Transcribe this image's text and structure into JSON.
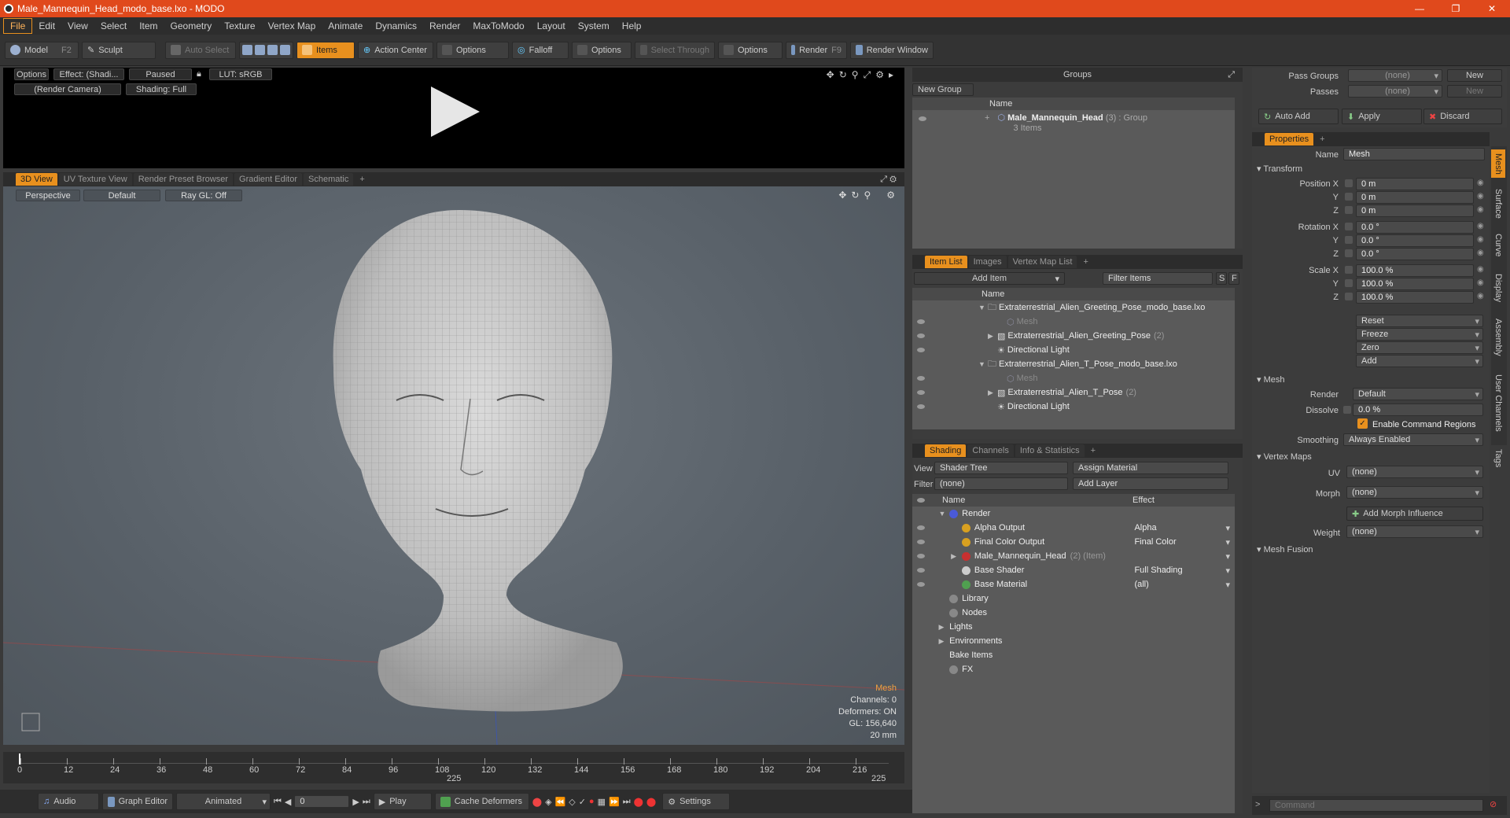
{
  "window": {
    "title": "Male_Mannequin_Head_modo_base.lxo - MODO",
    "min": "—",
    "max": "❐",
    "close": "✕"
  },
  "menu": [
    "File",
    "Edit",
    "View",
    "Select",
    "Item",
    "Geometry",
    "Texture",
    "Vertex Map",
    "Animate",
    "Dynamics",
    "Render",
    "MaxToModo",
    "Layout",
    "System",
    "Help"
  ],
  "toolbar": {
    "model": "Model",
    "model_key": "F2",
    "sculpt": "Sculpt",
    "auto_select": "Auto Select",
    "items": "Items",
    "action_center": "Action Center",
    "options1": "Options",
    "falloff": "Falloff",
    "options2": "Options",
    "select_through": "Select Through",
    "options3": "Options",
    "render": "Render",
    "render_key": "F9",
    "render_window": "Render Window"
  },
  "preview": {
    "options": "Options",
    "effect": "Effect: (Shadi...",
    "paused": "Paused",
    "lut": "LUT: sRGB",
    "camera": "(Render Camera)",
    "shading": "Shading: Full"
  },
  "viewport_tabs": [
    "3D View",
    "UV Texture View",
    "Render Preset Browser",
    "Gradient Editor",
    "Schematic",
    "+"
  ],
  "viewport": {
    "perspective": "Perspective",
    "default": "Default",
    "raygl": "Ray GL: Off",
    "info": {
      "mesh": "Mesh",
      "channels": "Channels: 0",
      "deformers": "Deformers: ON",
      "gl": "GL: 156,640",
      "scale": "20 mm"
    }
  },
  "timeline": {
    "ticks": [
      "0",
      "12",
      "24",
      "36",
      "48",
      "60",
      "72",
      "84",
      "96",
      "108",
      "120",
      "132",
      "144",
      "156",
      "168",
      "180",
      "192",
      "204",
      "216"
    ],
    "end_a": "225",
    "end_b": "225"
  },
  "bottombar": {
    "audio": "Audio",
    "graph_editor": "Graph Editor",
    "animated": "Animated",
    "frame": "0",
    "play": "Play",
    "cache": "Cache Deformers",
    "settings": "Settings"
  },
  "groups": {
    "title": "Groups",
    "new_group": "New Group",
    "col_name": "Name",
    "item_name": "Male_Mannequin_Head",
    "item_count": "(3)",
    "item_type": ": Group",
    "item_sub": "3 Items"
  },
  "itemlist": {
    "tabs": [
      "Item List",
      "Images",
      "Vertex Map List",
      "+"
    ],
    "add_item": "Add Item",
    "filter": "Filter Items",
    "s": "S",
    "f": "F",
    "col_name": "Name",
    "rows": [
      {
        "text": "Extraterrestrial_Alien_Greeting_Pose_modo_base.lxo",
        "indent": 0,
        "dim": false,
        "exp": "▼"
      },
      {
        "text": "Mesh",
        "indent": 2,
        "dim": true,
        "exp": ""
      },
      {
        "text": "Extraterrestrial_Alien_Greeting_Pose",
        "count": "(2)",
        "indent": 1,
        "dim": false,
        "exp": "▶"
      },
      {
        "text": "Directional Light",
        "indent": 1,
        "dim": false,
        "exp": ""
      },
      {
        "text": "Extraterrestrial_Alien_T_Pose_modo_base.lxo",
        "indent": 0,
        "dim": false,
        "exp": "▼"
      },
      {
        "text": "Mesh",
        "indent": 2,
        "dim": true,
        "exp": ""
      },
      {
        "text": "Extraterrestrial_Alien_T_Pose",
        "count": "(2)",
        "indent": 1,
        "dim": false,
        "exp": "▶"
      },
      {
        "text": "Directional Light",
        "indent": 1,
        "dim": false,
        "exp": ""
      }
    ]
  },
  "shading": {
    "tabs": [
      "Shading",
      "Channels",
      "Info & Statistics",
      "+"
    ],
    "view_label": "View",
    "view_value": "Shader Tree",
    "assign": "Assign Material",
    "filter_label": "Filter",
    "filter_value": "(none)",
    "add_layer": "Add Layer",
    "col_name": "Name",
    "col_effect": "Effect",
    "rows": [
      {
        "name": "Render",
        "effect": "",
        "indent": 0,
        "exp": "▼",
        "icon": "#4a5ad8",
        "eye": false,
        "dim": ""
      },
      {
        "name": "Alpha Output",
        "effect": "Alpha",
        "indent": 1,
        "exp": "",
        "icon": "#d8a020",
        "eye": true,
        "dim": ""
      },
      {
        "name": "Final Color Output",
        "effect": "Final Color",
        "indent": 1,
        "exp": "",
        "icon": "#d8a020",
        "eye": true,
        "dim": ""
      },
      {
        "name": "Male_Mannequin_Head",
        "effect": "",
        "indent": 1,
        "exp": "▶",
        "icon": "#c83030",
        "eye": true,
        "dim": "(2) (Item)"
      },
      {
        "name": "Base Shader",
        "effect": "Full Shading",
        "indent": 1,
        "exp": "",
        "icon": "#cccccc",
        "eye": true,
        "dim": ""
      },
      {
        "name": "Base Material",
        "effect": "(all)",
        "indent": 1,
        "exp": "",
        "icon": "#50a050",
        "eye": true,
        "dim": ""
      },
      {
        "name": "Library",
        "effect": "",
        "indent": 0,
        "exp": "",
        "icon": "#888888",
        "eye": false,
        "dim": ""
      },
      {
        "name": "Nodes",
        "effect": "",
        "indent": 0,
        "exp": "",
        "icon": "#888888",
        "eye": false,
        "dim": ""
      },
      {
        "name": "Lights",
        "effect": "",
        "indent": 0,
        "exp": "▶",
        "icon": "",
        "eye": false,
        "dim": ""
      },
      {
        "name": "Environments",
        "effect": "",
        "indent": 0,
        "exp": "▶",
        "icon": "",
        "eye": false,
        "dim": ""
      },
      {
        "name": "Bake Items",
        "effect": "",
        "indent": 0,
        "exp": "",
        "icon": "",
        "eye": false,
        "dim": ""
      },
      {
        "name": "FX",
        "effect": "",
        "indent": 0,
        "exp": "",
        "icon": "#888888",
        "eye": false,
        "dim": ""
      }
    ]
  },
  "passes": {
    "pass_groups": "Pass Groups",
    "pass_groups_value": "(none)",
    "new": "New",
    "passes": "Passes",
    "passes_value": "(none)",
    "new2": "New",
    "auto_add": "Auto Add",
    "apply": "Apply",
    "discard": "Discard"
  },
  "properties": {
    "tab": "Properties",
    "plus": "+",
    "name_label": "Name",
    "name_value": "Mesh",
    "transform": "Transform",
    "position_x": "Position X",
    "y": "Y",
    "z": "Z",
    "pos": [
      "0 m",
      "0 m",
      "0 m"
    ],
    "rotation_x": "Rotation X",
    "rot": [
      "0.0 °",
      "0.0 °",
      "0.0 °"
    ],
    "scale_x": "Scale X",
    "scl": [
      "100.0 %",
      "100.0 %",
      "100.0 %"
    ],
    "reset": "Reset",
    "freeze": "Freeze",
    "zero": "Zero",
    "add": "Add",
    "mesh": "Mesh",
    "render_label": "Render",
    "render_value": "Default",
    "dissolve_label": "Dissolve",
    "dissolve_value": "0.0 %",
    "enable_cmd": "Enable Command Regions",
    "smoothing_label": "Smoothing",
    "smoothing_value": "Always Enabled",
    "vertex_maps": "Vertex Maps",
    "uv_label": "UV",
    "uv_value": "(none)",
    "morph_label": "Morph",
    "morph_value": "(none)",
    "add_morph": "Add Morph Influence",
    "weight_label": "Weight",
    "weight_value": "(none)",
    "mesh_fusion": "Mesh Fusion",
    "side_tabs": [
      "Mesh",
      "Surface",
      "Curve",
      "Display",
      "Assembly",
      "User Channels",
      "Tags"
    ],
    "command_placeholder": "Command"
  },
  "colors": {
    "accent": "#e8901e",
    "titlebar": "#e0491c"
  }
}
